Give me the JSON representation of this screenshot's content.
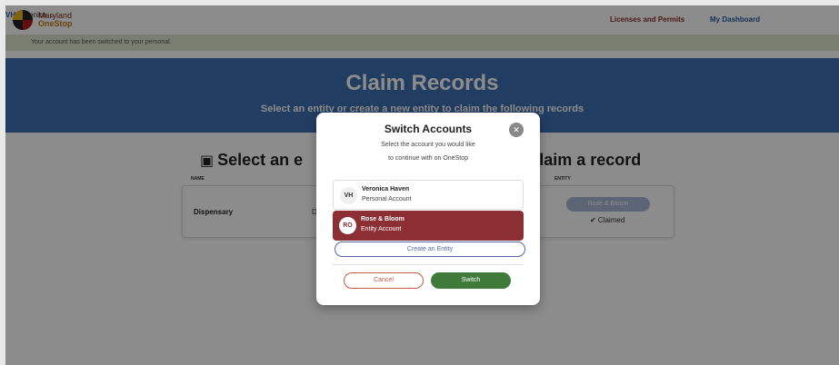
{
  "header": {
    "logo_line1": "Maryland",
    "logo_line2": "OneStop",
    "nav_licenses": "Licenses and Permits",
    "nav_dashboard": "My Dashboard",
    "user_initials": "VH",
    "user_name": "Veronica",
    "user_menu_icon": "chevron-down-icon"
  },
  "notice": "Your account has been switched to your personal.",
  "hero": {
    "title": "Claim Records",
    "subtitle": "Select an entity or create a new entity to claim the following records"
  },
  "records": {
    "heading_left": "Select an e",
    "heading_right": "laim a record",
    "col_name": "NAME",
    "col_entity": "ENTITY",
    "row": {
      "name": "Dispensary",
      "trunc": "D",
      "entity_value": "Rose & Bloom",
      "status": "✔ Claimed"
    }
  },
  "modal": {
    "title": "Switch Accounts",
    "close_icon": "close-icon",
    "desc_line1": "Select the account you would like",
    "desc_line2": "to continue with on OneStop",
    "accounts": [
      {
        "initials": "VH",
        "name": "Veronica Haven",
        "type": "Personal Account",
        "selected": false
      },
      {
        "initials": "RO",
        "name": "Rose & Bloom",
        "type": "Entity Account",
        "selected": true
      }
    ],
    "create_entity": "Create an Entity",
    "cancel": "Cancel",
    "switch": "Switch"
  },
  "colors": {
    "brand_blue": "#3e6fb3",
    "selected_account": "#8b2f35",
    "switch_button": "#3f7a3b",
    "cancel_border": "#c45a4a"
  }
}
